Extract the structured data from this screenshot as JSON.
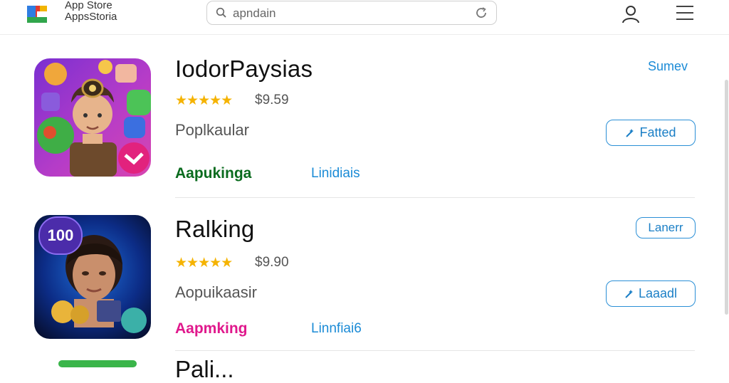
{
  "header": {
    "brand_line1": "App Store",
    "brand_line2": "AppsStoria",
    "search_value": "apndain"
  },
  "apps": [
    {
      "title": "IodorPaysias",
      "stars": "★★★★★",
      "price": "$9.59",
      "subtitle": "Poplkaular",
      "tag_primary": "Aapukinga",
      "tag_primary_color": "#0a6b1e",
      "tag_secondary": "Linidiais",
      "top_link": "Sumev",
      "action_label": "Fatted",
      "action_icon": "wand-icon"
    },
    {
      "title": "Ralking",
      "badge_text": "100",
      "stars": "★★★★★",
      "price": "$9.90",
      "subtitle": "Aopuikaasir",
      "tag_primary": "Aapmking",
      "tag_primary_color": "#e0188c",
      "tag_secondary": "Linnfiai6",
      "top_button": "Lanerr",
      "action_label": "Laaadl",
      "action_icon": "wand-icon"
    }
  ],
  "partial_title": "Pali..."
}
